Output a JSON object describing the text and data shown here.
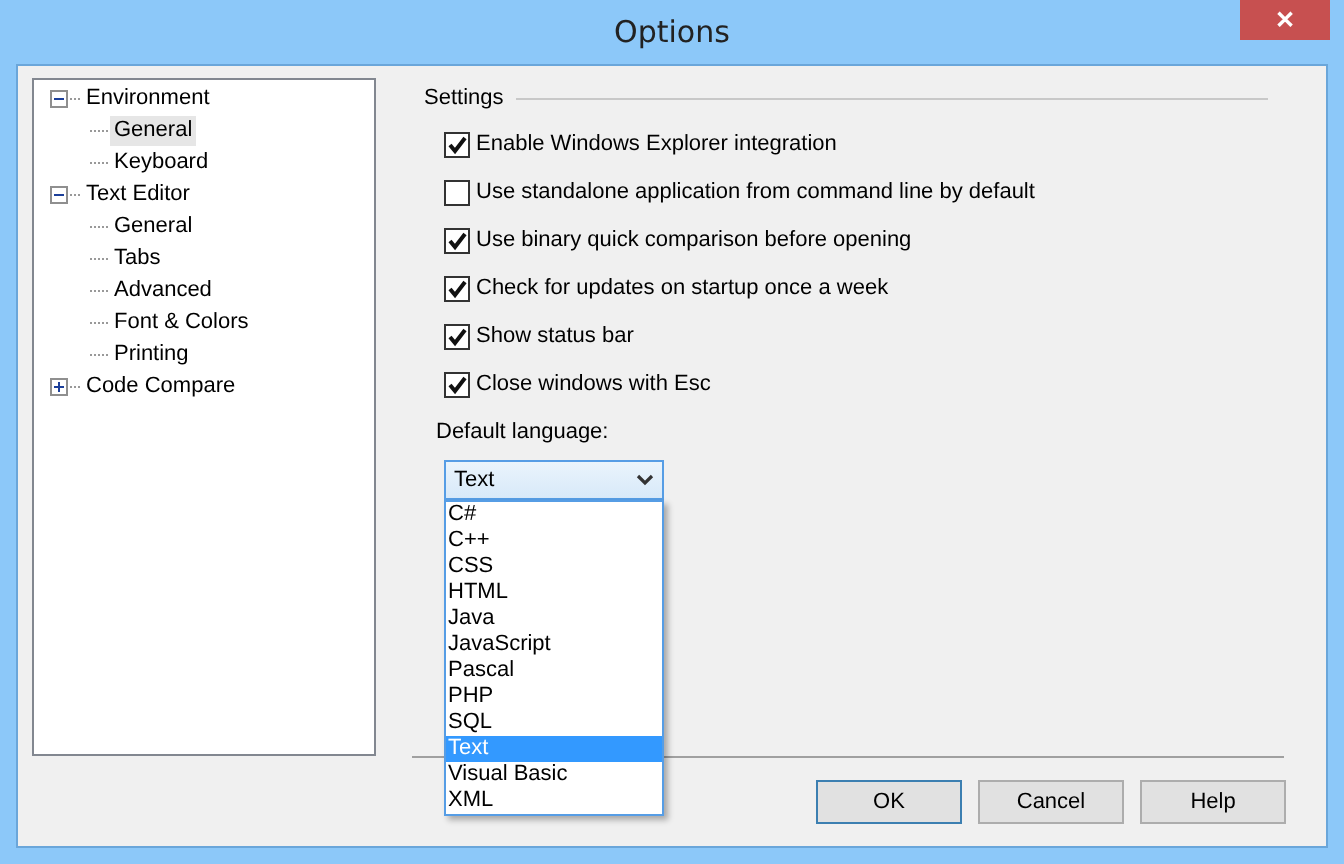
{
  "window": {
    "title": "Options",
    "close": "✕"
  },
  "tree": [
    {
      "label": "Environment",
      "expanded": true,
      "selected": false,
      "children": [
        {
          "label": "General",
          "selected": true
        },
        {
          "label": "Keyboard",
          "selected": false
        }
      ]
    },
    {
      "label": "Text Editor",
      "expanded": true,
      "selected": false,
      "children": [
        {
          "label": "General",
          "selected": false
        },
        {
          "label": "Tabs",
          "selected": false
        },
        {
          "label": "Advanced",
          "selected": false
        },
        {
          "label": "Font & Colors",
          "selected": false
        },
        {
          "label": "Printing",
          "selected": false
        }
      ]
    },
    {
      "label": "Code Compare",
      "expanded": false,
      "selected": false
    }
  ],
  "settings": {
    "title": "Settings",
    "options": [
      {
        "label": "Enable Windows Explorer integration",
        "checked": true
      },
      {
        "label": "Use standalone application from command line by default",
        "checked": false
      },
      {
        "label": "Use binary quick comparison before opening",
        "checked": true
      },
      {
        "label": "Check for updates on startup once a week",
        "checked": true
      },
      {
        "label": "Show status bar",
        "checked": true
      },
      {
        "label": "Close windows with Esc",
        "checked": true
      }
    ]
  },
  "default_language": {
    "label": "Default language:",
    "value": "Text",
    "expanded": true,
    "options": [
      {
        "label": "C#",
        "selected": false
      },
      {
        "label": "C++",
        "selected": false
      },
      {
        "label": "CSS",
        "selected": false
      },
      {
        "label": "HTML",
        "selected": false
      },
      {
        "label": "Java",
        "selected": false
      },
      {
        "label": "JavaScript",
        "selected": false
      },
      {
        "label": "Pascal",
        "selected": false
      },
      {
        "label": "PHP",
        "selected": false
      },
      {
        "label": "SQL",
        "selected": false
      },
      {
        "label": "Text",
        "selected": true
      },
      {
        "label": "Visual Basic",
        "selected": false
      },
      {
        "label": "XML",
        "selected": false
      }
    ]
  },
  "buttons": [
    {
      "label": "OK",
      "default": true
    },
    {
      "label": "Cancel",
      "default": false
    },
    {
      "label": "Help",
      "default": false
    }
  ]
}
